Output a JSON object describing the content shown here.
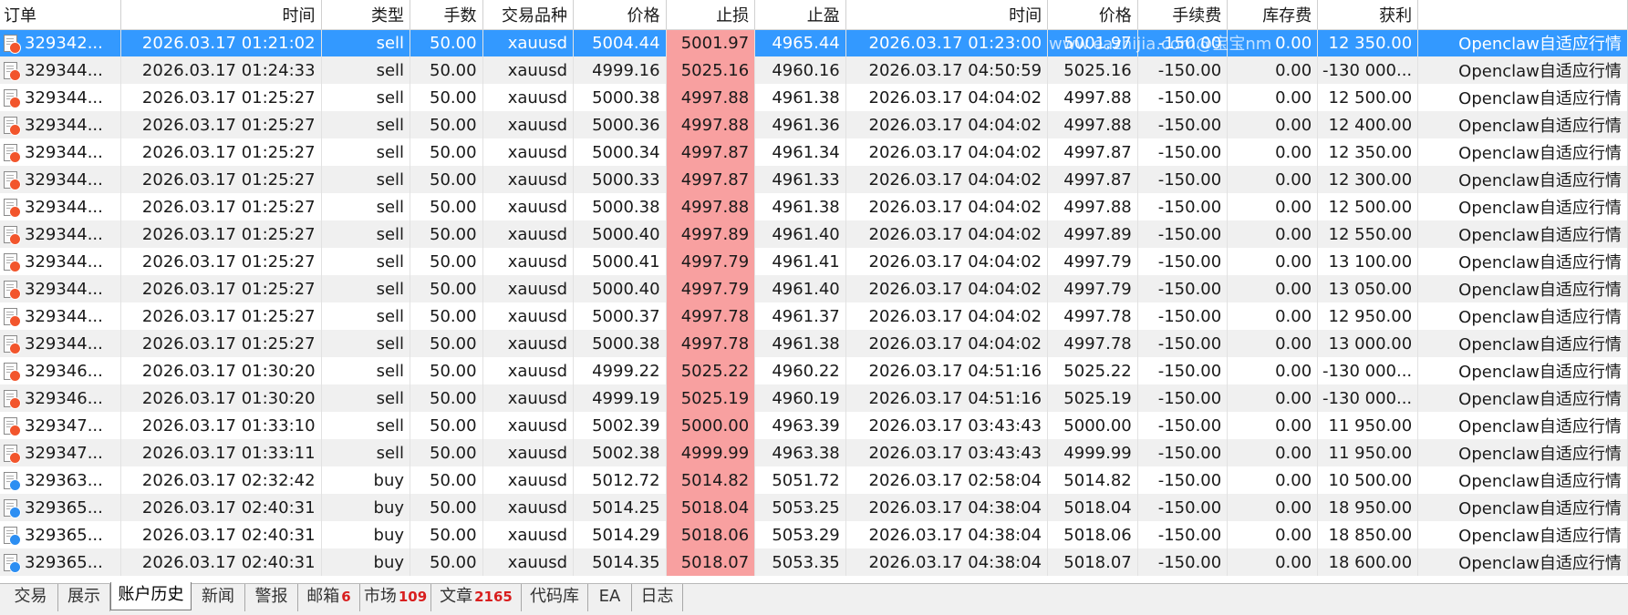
{
  "columns": [
    "订单",
    "时间",
    "类型",
    "手数",
    "交易品种",
    "价格",
    "止损",
    "止盈",
    "时间",
    "价格",
    "手续费",
    "库存费",
    "获利",
    ""
  ],
  "watermark": "www.eazhijia.com@宝宝nm",
  "colors": {
    "selected": "#3399ff",
    "stop_loss_cell": "#f8a0a0",
    "sell_dot": "#f2552c",
    "buy_dot": "#2c8ef2",
    "badge": "#d81e1e"
  },
  "rows": [
    {
      "order": "329342...",
      "open_time": "2026.03.17 01:21:02",
      "type": "sell",
      "lots": "50.00",
      "symbol": "xauusd",
      "open_price": "5004.44",
      "sl": "5001.97",
      "tp": "4965.44",
      "close_time": "2026.03.17 01:23:00",
      "close_price": "5001.97",
      "commission": "-150.00",
      "swap": "0.00",
      "profit": "12 350.00",
      "comment": "Openclaw自适应行情",
      "icon": "sell-order-icon",
      "selected": true
    },
    {
      "order": "329344...",
      "open_time": "2026.03.17 01:24:33",
      "type": "sell",
      "lots": "50.00",
      "symbol": "xauusd",
      "open_price": "4999.16",
      "sl": "5025.16",
      "tp": "4960.16",
      "close_time": "2026.03.17 04:50:59",
      "close_price": "5025.16",
      "commission": "-150.00",
      "swap": "0.00",
      "profit": "-130 000...",
      "comment": "Openclaw自适应行情",
      "icon": "sell-order-icon",
      "selected": false
    },
    {
      "order": "329344...",
      "open_time": "2026.03.17 01:25:27",
      "type": "sell",
      "lots": "50.00",
      "symbol": "xauusd",
      "open_price": "5000.38",
      "sl": "4997.88",
      "tp": "4961.38",
      "close_time": "2026.03.17 04:04:02",
      "close_price": "4997.88",
      "commission": "-150.00",
      "swap": "0.00",
      "profit": "12 500.00",
      "comment": "Openclaw自适应行情",
      "icon": "sell-order-icon",
      "selected": false
    },
    {
      "order": "329344...",
      "open_time": "2026.03.17 01:25:27",
      "type": "sell",
      "lots": "50.00",
      "symbol": "xauusd",
      "open_price": "5000.36",
      "sl": "4997.88",
      "tp": "4961.36",
      "close_time": "2026.03.17 04:04:02",
      "close_price": "4997.88",
      "commission": "-150.00",
      "swap": "0.00",
      "profit": "12 400.00",
      "comment": "Openclaw自适应行情",
      "icon": "sell-order-icon",
      "selected": false
    },
    {
      "order": "329344...",
      "open_time": "2026.03.17 01:25:27",
      "type": "sell",
      "lots": "50.00",
      "symbol": "xauusd",
      "open_price": "5000.34",
      "sl": "4997.87",
      "tp": "4961.34",
      "close_time": "2026.03.17 04:04:02",
      "close_price": "4997.87",
      "commission": "-150.00",
      "swap": "0.00",
      "profit": "12 350.00",
      "comment": "Openclaw自适应行情",
      "icon": "sell-order-icon",
      "selected": false
    },
    {
      "order": "329344...",
      "open_time": "2026.03.17 01:25:27",
      "type": "sell",
      "lots": "50.00",
      "symbol": "xauusd",
      "open_price": "5000.33",
      "sl": "4997.87",
      "tp": "4961.33",
      "close_time": "2026.03.17 04:04:02",
      "close_price": "4997.87",
      "commission": "-150.00",
      "swap": "0.00",
      "profit": "12 300.00",
      "comment": "Openclaw自适应行情",
      "icon": "sell-order-icon",
      "selected": false
    },
    {
      "order": "329344...",
      "open_time": "2026.03.17 01:25:27",
      "type": "sell",
      "lots": "50.00",
      "symbol": "xauusd",
      "open_price": "5000.38",
      "sl": "4997.88",
      "tp": "4961.38",
      "close_time": "2026.03.17 04:04:02",
      "close_price": "4997.88",
      "commission": "-150.00",
      "swap": "0.00",
      "profit": "12 500.00",
      "comment": "Openclaw自适应行情",
      "icon": "sell-order-icon",
      "selected": false
    },
    {
      "order": "329344...",
      "open_time": "2026.03.17 01:25:27",
      "type": "sell",
      "lots": "50.00",
      "symbol": "xauusd",
      "open_price": "5000.40",
      "sl": "4997.89",
      "tp": "4961.40",
      "close_time": "2026.03.17 04:04:02",
      "close_price": "4997.89",
      "commission": "-150.00",
      "swap": "0.00",
      "profit": "12 550.00",
      "comment": "Openclaw自适应行情",
      "icon": "sell-order-icon",
      "selected": false
    },
    {
      "order": "329344...",
      "open_time": "2026.03.17 01:25:27",
      "type": "sell",
      "lots": "50.00",
      "symbol": "xauusd",
      "open_price": "5000.41",
      "sl": "4997.79",
      "tp": "4961.41",
      "close_time": "2026.03.17 04:04:02",
      "close_price": "4997.79",
      "commission": "-150.00",
      "swap": "0.00",
      "profit": "13 100.00",
      "comment": "Openclaw自适应行情",
      "icon": "sell-order-icon",
      "selected": false
    },
    {
      "order": "329344...",
      "open_time": "2026.03.17 01:25:27",
      "type": "sell",
      "lots": "50.00",
      "symbol": "xauusd",
      "open_price": "5000.40",
      "sl": "4997.79",
      "tp": "4961.40",
      "close_time": "2026.03.17 04:04:02",
      "close_price": "4997.79",
      "commission": "-150.00",
      "swap": "0.00",
      "profit": "13 050.00",
      "comment": "Openclaw自适应行情",
      "icon": "sell-order-icon",
      "selected": false
    },
    {
      "order": "329344...",
      "open_time": "2026.03.17 01:25:27",
      "type": "sell",
      "lots": "50.00",
      "symbol": "xauusd",
      "open_price": "5000.37",
      "sl": "4997.78",
      "tp": "4961.37",
      "close_time": "2026.03.17 04:04:02",
      "close_price": "4997.78",
      "commission": "-150.00",
      "swap": "0.00",
      "profit": "12 950.00",
      "comment": "Openclaw自适应行情",
      "icon": "sell-order-icon",
      "selected": false
    },
    {
      "order": "329344...",
      "open_time": "2026.03.17 01:25:27",
      "type": "sell",
      "lots": "50.00",
      "symbol": "xauusd",
      "open_price": "5000.38",
      "sl": "4997.78",
      "tp": "4961.38",
      "close_time": "2026.03.17 04:04:02",
      "close_price": "4997.78",
      "commission": "-150.00",
      "swap": "0.00",
      "profit": "13 000.00",
      "comment": "Openclaw自适应行情",
      "icon": "sell-order-icon",
      "selected": false
    },
    {
      "order": "329346...",
      "open_time": "2026.03.17 01:30:20",
      "type": "sell",
      "lots": "50.00",
      "symbol": "xauusd",
      "open_price": "4999.22",
      "sl": "5025.22",
      "tp": "4960.22",
      "close_time": "2026.03.17 04:51:16",
      "close_price": "5025.22",
      "commission": "-150.00",
      "swap": "0.00",
      "profit": "-130 000...",
      "comment": "Openclaw自适应行情",
      "icon": "sell-order-icon",
      "selected": false
    },
    {
      "order": "329346...",
      "open_time": "2026.03.17 01:30:20",
      "type": "sell",
      "lots": "50.00",
      "symbol": "xauusd",
      "open_price": "4999.19",
      "sl": "5025.19",
      "tp": "4960.19",
      "close_time": "2026.03.17 04:51:16",
      "close_price": "5025.19",
      "commission": "-150.00",
      "swap": "0.00",
      "profit": "-130 000...",
      "comment": "Openclaw自适应行情",
      "icon": "sell-order-icon",
      "selected": false
    },
    {
      "order": "329347...",
      "open_time": "2026.03.17 01:33:10",
      "type": "sell",
      "lots": "50.00",
      "symbol": "xauusd",
      "open_price": "5002.39",
      "sl": "5000.00",
      "tp": "4963.39",
      "close_time": "2026.03.17 03:43:43",
      "close_price": "5000.00",
      "commission": "-150.00",
      "swap": "0.00",
      "profit": "11 950.00",
      "comment": "Openclaw自适应行情",
      "icon": "sell-order-icon",
      "selected": false
    },
    {
      "order": "329347...",
      "open_time": "2026.03.17 01:33:11",
      "type": "sell",
      "lots": "50.00",
      "symbol": "xauusd",
      "open_price": "5002.38",
      "sl": "4999.99",
      "tp": "4963.38",
      "close_time": "2026.03.17 03:43:43",
      "close_price": "4999.99",
      "commission": "-150.00",
      "swap": "0.00",
      "profit": "11 950.00",
      "comment": "Openclaw自适应行情",
      "icon": "sell-order-icon",
      "selected": false
    },
    {
      "order": "329363...",
      "open_time": "2026.03.17 02:32:42",
      "type": "buy",
      "lots": "50.00",
      "symbol": "xauusd",
      "open_price": "5012.72",
      "sl": "5014.82",
      "tp": "5051.72",
      "close_time": "2026.03.17 02:58:04",
      "close_price": "5014.82",
      "commission": "-150.00",
      "swap": "0.00",
      "profit": "10 500.00",
      "comment": "Openclaw自适应行情",
      "icon": "buy-order-icon",
      "selected": false
    },
    {
      "order": "329365...",
      "open_time": "2026.03.17 02:40:31",
      "type": "buy",
      "lots": "50.00",
      "symbol": "xauusd",
      "open_price": "5014.25",
      "sl": "5018.04",
      "tp": "5053.25",
      "close_time": "2026.03.17 04:38:04",
      "close_price": "5018.04",
      "commission": "-150.00",
      "swap": "0.00",
      "profit": "18 950.00",
      "comment": "Openclaw自适应行情",
      "icon": "buy-order-icon",
      "selected": false
    },
    {
      "order": "329365...",
      "open_time": "2026.03.17 02:40:31",
      "type": "buy",
      "lots": "50.00",
      "symbol": "xauusd",
      "open_price": "5014.29",
      "sl": "5018.06",
      "tp": "5053.29",
      "close_time": "2026.03.17 04:38:04",
      "close_price": "5018.06",
      "commission": "-150.00",
      "swap": "0.00",
      "profit": "18 850.00",
      "comment": "Openclaw自适应行情",
      "icon": "buy-order-icon",
      "selected": false
    },
    {
      "order": "329365...",
      "open_time": "2026.03.17 02:40:31",
      "type": "buy",
      "lots": "50.00",
      "symbol": "xauusd",
      "open_price": "5014.35",
      "sl": "5018.07",
      "tp": "5053.35",
      "close_time": "2026.03.17 04:38:04",
      "close_price": "5018.07",
      "commission": "-150.00",
      "swap": "0.00",
      "profit": "18 600.00",
      "comment": "Openclaw自适应行情",
      "icon": "buy-order-icon",
      "selected": false
    }
  ],
  "tabs": [
    {
      "label": "交易",
      "badge": "",
      "active": false,
      "name": "tab-trade"
    },
    {
      "label": "展示",
      "badge": "",
      "active": false,
      "name": "tab-exposure"
    },
    {
      "label": "账户历史",
      "badge": "",
      "active": true,
      "name": "tab-account-history"
    },
    {
      "label": "新闻",
      "badge": "",
      "active": false,
      "name": "tab-news"
    },
    {
      "label": "警报",
      "badge": "",
      "active": false,
      "name": "tab-alerts"
    },
    {
      "label": "邮箱",
      "badge": "6",
      "active": false,
      "name": "tab-mailbox"
    },
    {
      "label": "市场",
      "badge": "109",
      "active": false,
      "name": "tab-market"
    },
    {
      "label": "文章",
      "badge": "2165",
      "active": false,
      "name": "tab-articles"
    },
    {
      "label": "代码库",
      "badge": "",
      "active": false,
      "name": "tab-code-base"
    },
    {
      "label": "EA",
      "badge": "",
      "active": false,
      "name": "tab-ea"
    },
    {
      "label": "日志",
      "badge": "",
      "active": false,
      "name": "tab-journal"
    }
  ]
}
